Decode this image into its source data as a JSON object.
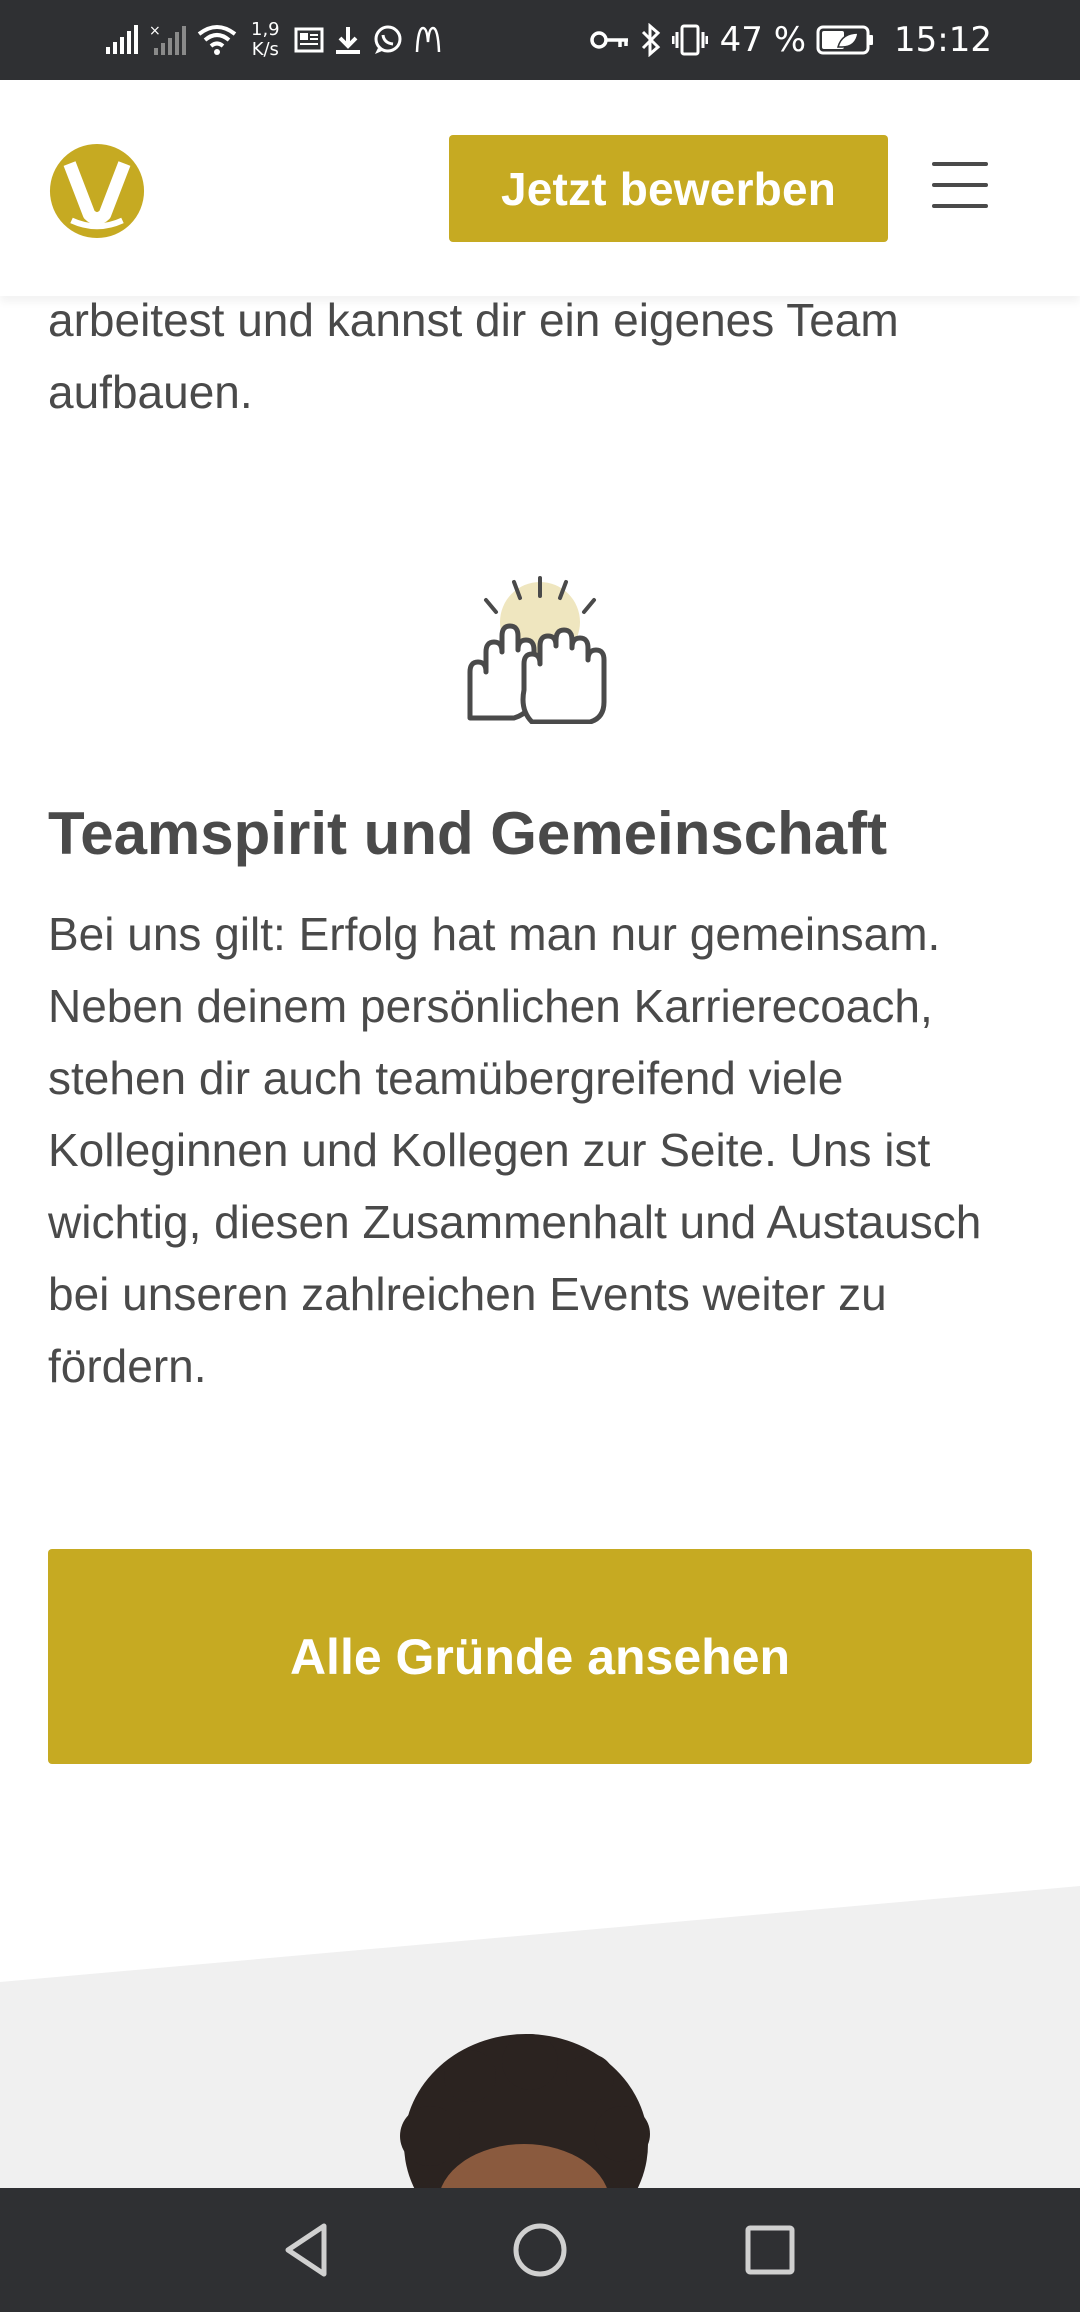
{
  "status_bar": {
    "net_speed_value": "1,9",
    "net_speed_unit": "K/s",
    "battery_percent": "47 %",
    "time": "15:12",
    "icons": [
      "signal-icon",
      "signal-no-sim-icon",
      "wifi-icon",
      "news-icon",
      "download-icon",
      "whatsapp-icon",
      "mcdonalds-icon",
      "key-icon",
      "bluetooth-icon",
      "vibrate-icon",
      "battery-icon"
    ]
  },
  "header": {
    "logo_icon": "brand-logo-icon",
    "apply_button_label": "Jetzt bewerben",
    "menu_icon": "hamburger-menu-icon"
  },
  "intro": {
    "text": "arbeitest und kannst dir ein eigenes Team aufbauen."
  },
  "section": {
    "icon": "high-five-hands-icon",
    "title": "Teamspirit und Gemeinschaft",
    "body": "Bei uns gilt: Erfolg hat man nur gemeinsam. Neben deinem persönlichen Karrierecoach, stehen dir auch teamübergreifend viele Kolleginnen und Kollegen zur Seite. Uns ist wichtig, diesen Zusammenhalt und Austausch bei unseren zahlreichen Events weiter zu fördern."
  },
  "cta": {
    "all_reasons_label": "Alle Gründe ansehen"
  },
  "colors": {
    "accent": "#c6aa22",
    "text": "#4a4a4a",
    "system_bar": "#2f3033",
    "gray_section": "#f0f0f0",
    "icon_highlight": "#efe6bf"
  },
  "nav_bar": {
    "icons": [
      "back-icon",
      "home-icon",
      "recents-icon"
    ]
  }
}
